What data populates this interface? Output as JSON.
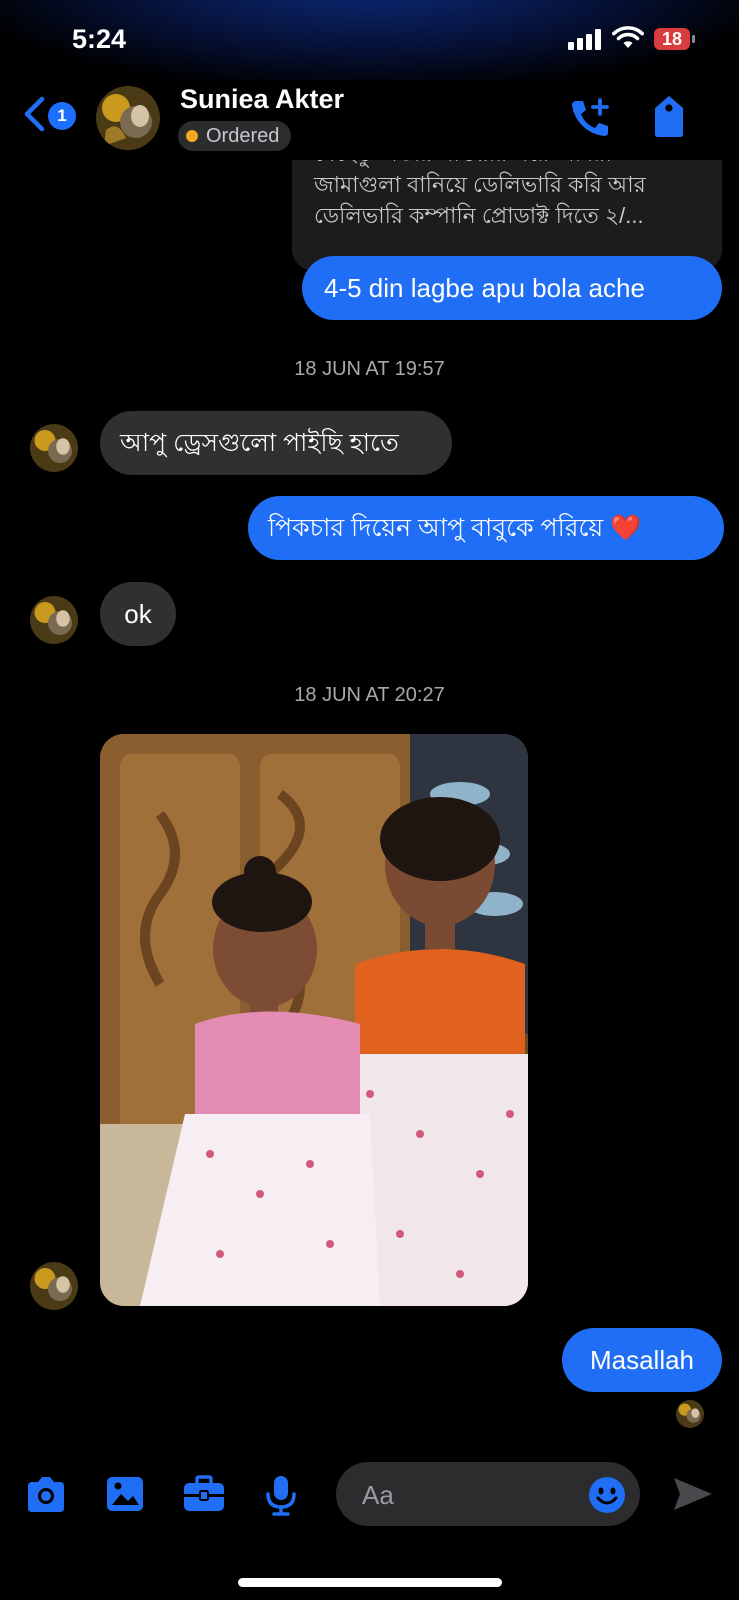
{
  "status_bar": {
    "time": "5:24",
    "battery": "18"
  },
  "header": {
    "back_badge": "1",
    "contact_name": "Suniea Akter",
    "status": "Ordered"
  },
  "conversation": {
    "quoted_message_lines": [
      "যেহেতু অডার পাওয়ার পরে আমরা",
      "জামাগুলা বানিয়ে ডেলিভারি করি আর",
      "ডেলিভারি কম্পানি প্রোডাক্ট দিতে ২/..."
    ],
    "msg_out_1": "4-5 din lagbe apu bola ache",
    "timestamp_1": "18 JUN AT 19:57",
    "msg_in_1": "আপু ড্রেসগুলো পাইছি হাতে",
    "msg_out_2": "পিকচার দিয়েন আপু বাবুকে পরিয়ে ❤️",
    "msg_in_2": "ok",
    "timestamp_2": "18 JUN AT 20:27",
    "msg_out_3": "Masallah"
  },
  "composer": {
    "placeholder": "Aa"
  },
  "icons": [
    "chevron-left-icon",
    "phone-plus-icon",
    "tag-icon",
    "camera-icon",
    "image-icon",
    "briefcase-icon",
    "microphone-icon",
    "emoji-icon",
    "send-icon"
  ],
  "colors": {
    "accent": "#1f6ef5",
    "incoming_bubble": "#303033",
    "status_dot": "#f5a623",
    "battery": "#d93c3c"
  }
}
